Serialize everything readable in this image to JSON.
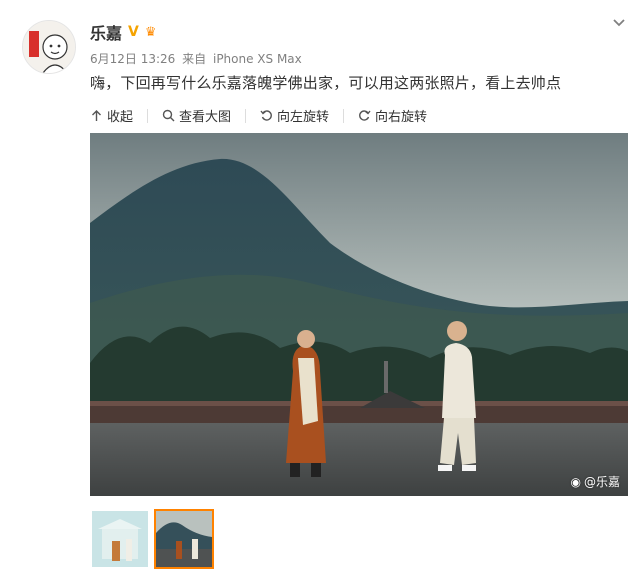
{
  "post": {
    "author": "乐嘉",
    "date": "6月12日 13:26",
    "via": "来自",
    "device": "iPhone XS Max",
    "text": "嗨，下回再写什么乐嘉落魄学佛出家，可以用这两张照片，看上去帅点"
  },
  "toolbar": {
    "collapse": "收起",
    "view_large": "查看大图",
    "rotate_left": "向左旋转",
    "rotate_right": "向右旋转"
  },
  "photo": {
    "watermark": "@乐嘉"
  },
  "thumbnails": {
    "count": 2,
    "selected_index": 1
  },
  "colors": {
    "accent": "#ff8200",
    "verified": "#f5a300",
    "meta_text": "#808080"
  }
}
